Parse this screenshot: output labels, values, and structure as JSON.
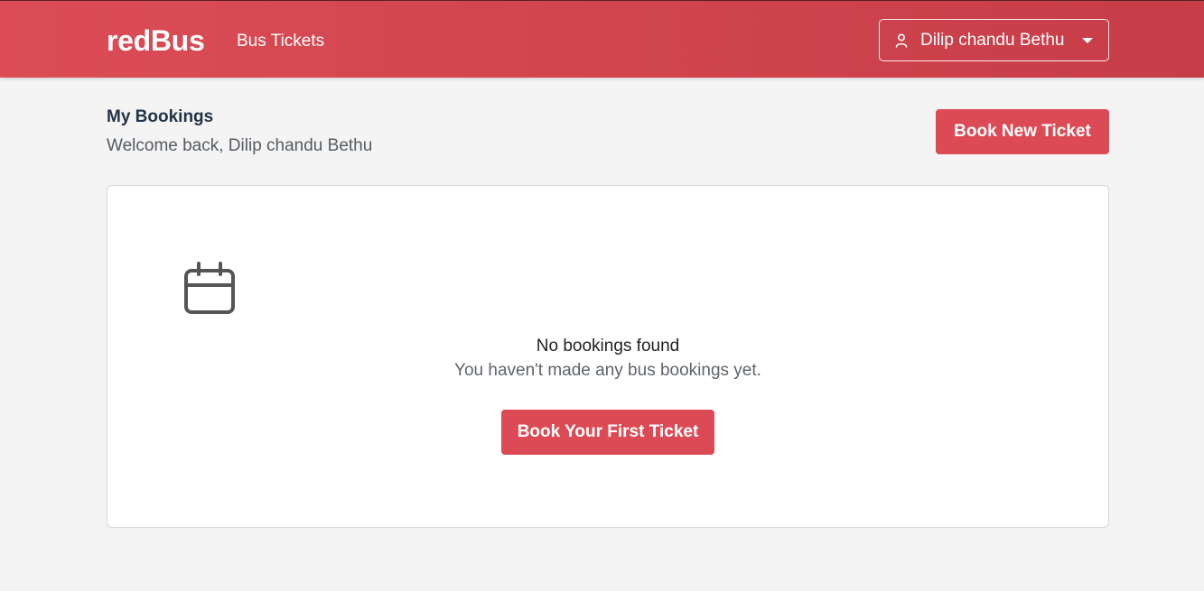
{
  "header": {
    "brand": "redBus",
    "nav_link": "Bus Tickets",
    "user_name": "Dilip chandu Bethu",
    "icons": {
      "user": "user-icon",
      "dropdown": "caret-down-icon"
    }
  },
  "page": {
    "title": "My Bookings",
    "welcome": "Welcome back, Dilip chandu Bethu",
    "book_new_label": "Book New Ticket"
  },
  "empty_state": {
    "icon": "calendar-icon",
    "title": "No bookings found",
    "subtitle": "You haven't made any bus bookings yet.",
    "cta_label": "Book Your First Ticket"
  },
  "colors": {
    "brand_red": "#dc4b55",
    "background": "#f4f4f4",
    "card": "#ffffff"
  }
}
